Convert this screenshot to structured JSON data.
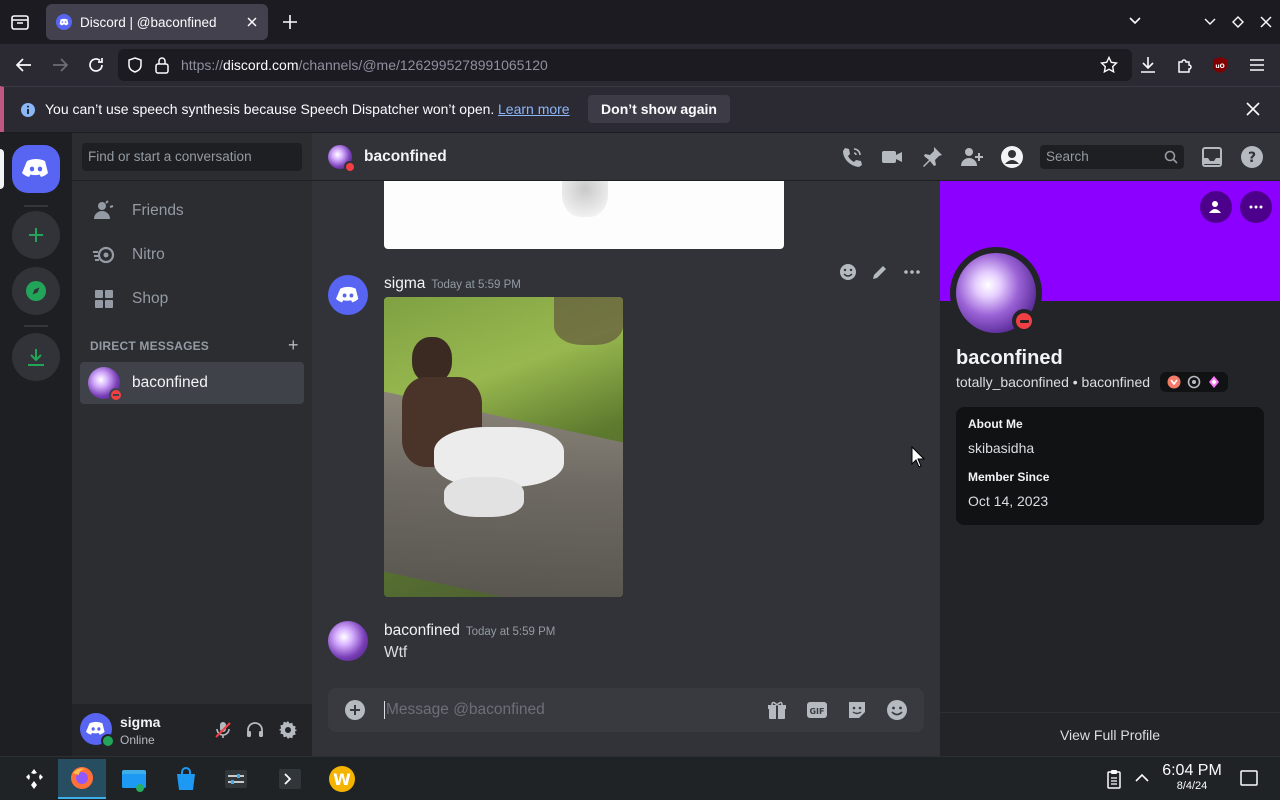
{
  "browser": {
    "tab_title": "Discord | @baconfined",
    "url_prefix": "https://",
    "url_host": "discord.com",
    "url_path": "/channels/@me/1262995278991065120"
  },
  "notification": {
    "message": "You can’t use speech synthesis because Speech Dispatcher won’t open.",
    "learn_more": "Learn more",
    "dont_show": "Don’t show again"
  },
  "dm_sidebar": {
    "search_placeholder": "Find or start a conversation",
    "nav": [
      {
        "label": "Friends",
        "icon": "friends-icon"
      },
      {
        "label": "Nitro",
        "icon": "nitro-icon"
      },
      {
        "label": "Shop",
        "icon": "shop-icon"
      }
    ],
    "dm_header": "DIRECT MESSAGES",
    "dm_add": "+",
    "dms": [
      {
        "name": "baconfined",
        "status": "dnd"
      }
    ]
  },
  "user_panel": {
    "name": "sigma",
    "status": "Online"
  },
  "chat": {
    "channel_name": "baconfined",
    "search_placeholder": "Search",
    "messages": [
      {
        "author": "sigma",
        "time": "Today at 5:59 PM",
        "attachment": "image"
      },
      {
        "author": "baconfined",
        "time": "Today at 5:59 PM",
        "text": "Wtf"
      }
    ],
    "composer_placeholder": "Message @baconfined"
  },
  "profile": {
    "display_name": "baconfined",
    "username_line": "totally_baconfined • baconfined",
    "about_title": "About Me",
    "about_text": "skibasidha",
    "member_title": "Member Since",
    "member_date": "Oct 14, 2023",
    "view_full": "View Full Profile"
  },
  "taskbar": {
    "time": "6:04 PM",
    "date": "8/4/24"
  },
  "colors": {
    "blurple": "#5865f2",
    "banner": "#8b00ff",
    "green": "#23a559",
    "dnd": "#f23f43"
  }
}
